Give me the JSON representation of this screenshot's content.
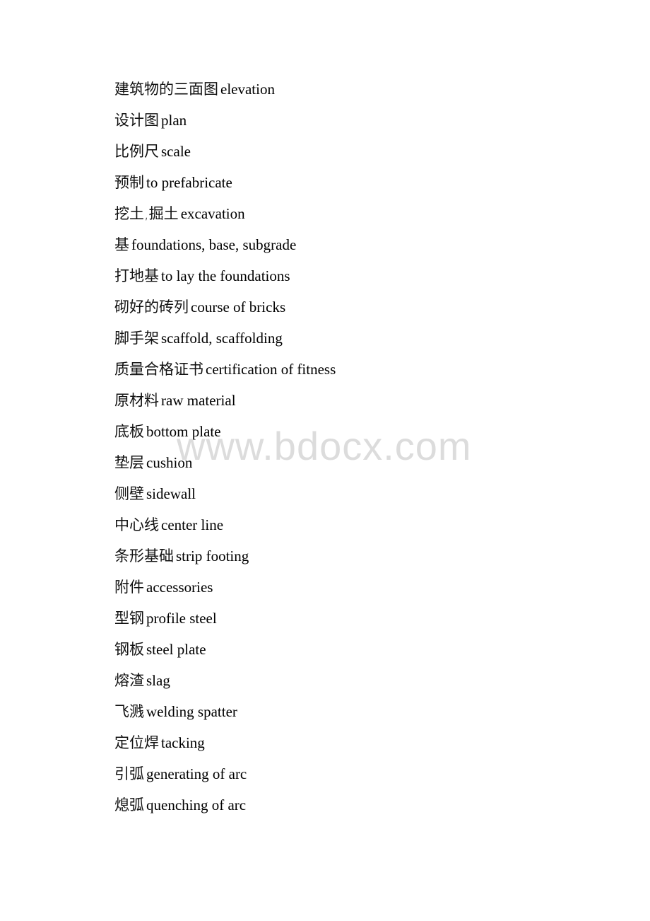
{
  "document": {
    "entries": [
      {
        "zh": "建筑物的三面图",
        "en": "elevation"
      },
      {
        "zh": "设计图",
        "en": "plan"
      },
      {
        "zh": "比例尺",
        "en": "scale"
      },
      {
        "zh": "预制",
        "en": "to prefabricate"
      },
      {
        "zh": "挖土,掘土",
        "en": "excavation"
      },
      {
        "zh": "基",
        "en": "foundations, base, subgrade"
      },
      {
        "zh": "打地基",
        "en": "to lay the foundations"
      },
      {
        "zh": "砌好的砖列",
        "en": "course of bricks"
      },
      {
        "zh": "脚手架",
        "en": "scaffold, scaffolding"
      },
      {
        "zh": "质量合格证书",
        "en": "certification of fitness"
      },
      {
        "zh": "原材料",
        "en": "raw material"
      },
      {
        "zh": "底板",
        "en": "bottom plate"
      },
      {
        "zh": "垫层",
        "en": "cushion"
      },
      {
        "zh": "侧壁",
        "en": "sidewall"
      },
      {
        "zh": "中心线",
        "en": "center line"
      },
      {
        "zh": "条形基础",
        "en": "strip footing"
      },
      {
        "zh": "附件",
        "en": "accessories"
      },
      {
        "zh": "型钢",
        "en": "profile steel"
      },
      {
        "zh": "钢板",
        "en": "steel plate"
      },
      {
        "zh": "熔渣",
        "en": "slag"
      },
      {
        "zh": "飞溅",
        "en": "welding spatter"
      },
      {
        "zh": "定位焊",
        "en": "tacking"
      },
      {
        "zh": "引弧",
        "en": "generating of arc"
      },
      {
        "zh": "熄弧",
        "en": "quenching of arc"
      }
    ]
  },
  "watermark": {
    "text": "www.bdocx.com",
    "color": "#dcdcdc"
  }
}
